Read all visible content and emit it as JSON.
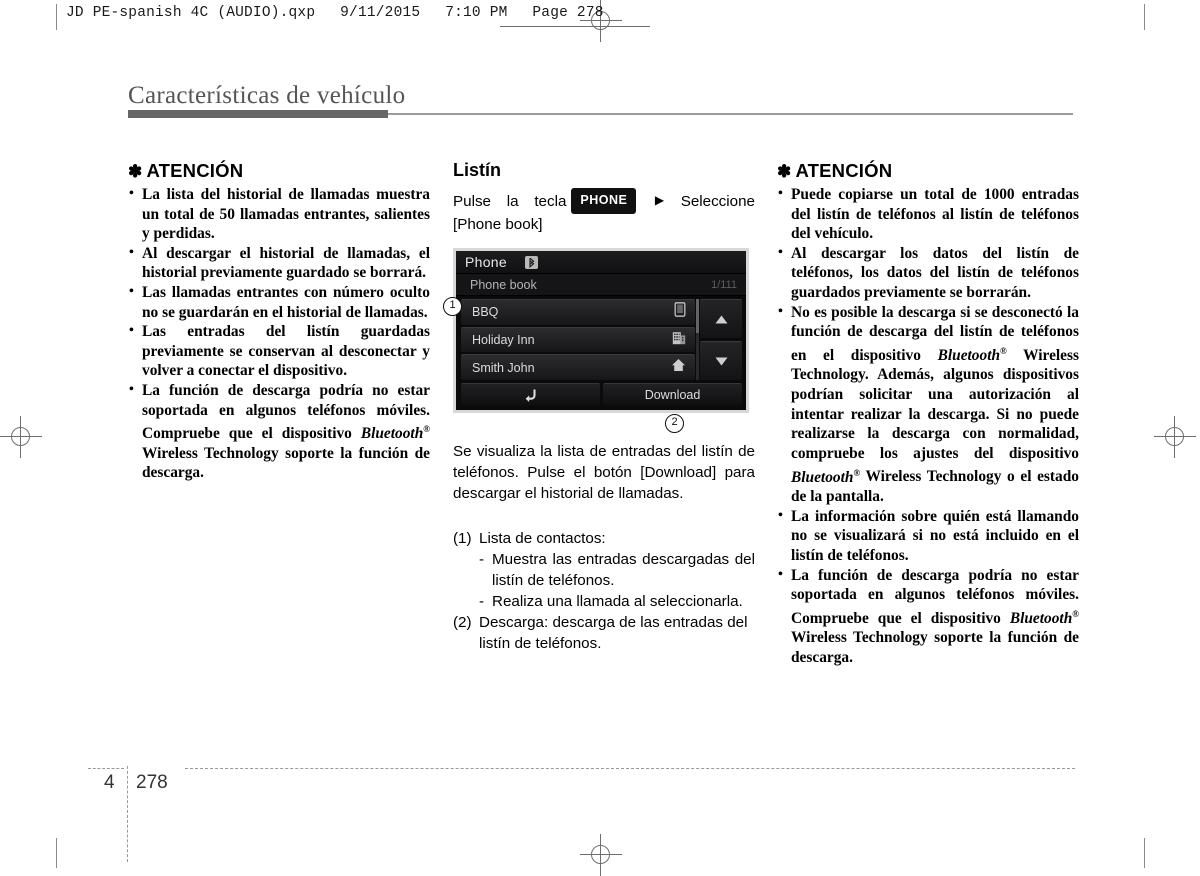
{
  "print_header": {
    "filename": "JD PE-spanish 4C (AUDIO).qxp",
    "date": "9/11/2015",
    "time": "7:10 PM",
    "page_label": "Page 278"
  },
  "page_title": "Características de vehículo",
  "left_notice": {
    "heading": "ATENCIÓN",
    "star": "✽",
    "items": [
      "La lista del historial de llamadas muestra un total de 50 llamadas entrantes, salientes y perdidas.",
      "Al descargar el historial de llamadas, el historial previamente guardado se borrará.",
      "Las llamadas entrantes con número oculto no se guardarán en el historial de llamadas.",
      "Las entradas del listín guardadas previamente se conservan al desconectar y volver a conectar el dispositivo."
    ],
    "last_item_prefix": "La función de descarga podría no estar soportada en algunos teléfonos móviles. Compruebe que el dispositivo ",
    "bluetooth_word": "Bluetooth",
    "registered": "®",
    "last_item_suffix": " Wireless Technology soporte la función de descarga."
  },
  "middle": {
    "section_heading": "Listín",
    "step_prefix": "Pulse la tecla",
    "key_label": "PHONE",
    "arrow": "▶",
    "step_suffix": "Seleccione [Phone book]",
    "description": "Se visualiza la lista de entradas del listín de teléfonos. Pulse el botón [Download] para descargar el historial de llamadas.",
    "numbered_list": [
      {
        "num": "(1)",
        "text": "Lista de contactos:",
        "subitems": [
          "Muestra las entradas descargadas del listín de teléfonos.",
          "Realiza una llamada al seleccionarla."
        ]
      },
      {
        "num": "(2)",
        "text": "Descarga: descarga de las entradas del listín de teléfonos.",
        "subitems": []
      }
    ],
    "dash": "-"
  },
  "device_screen": {
    "title": "Phone",
    "bluetooth_glyph": "ᛒ",
    "subtitle": "Phone book",
    "page_indicator": "1/111",
    "rows": [
      {
        "label": "BBQ",
        "icon": "mobile-phone-icon"
      },
      {
        "label": "Holiday Inn",
        "icon": "office-building-icon"
      },
      {
        "label": "Smith John",
        "icon": "home-icon"
      }
    ],
    "scroll_up": "▲",
    "scroll_down": "▼",
    "back_button": "↰",
    "download_button": "Download",
    "callout_1": "1",
    "callout_2": "2"
  },
  "right_notice": {
    "heading": "ATENCIÓN",
    "star": "✽",
    "items": [
      "Puede copiarse un total de 1000 entradas del listín de teléfonos al listín de teléfonos del vehículo.",
      "Al descargar los datos del listín de teléfonos, los datos del listín de teléfonos guardados previamente se borrarán."
    ],
    "item3": {
      "part1": "No es posible la descarga si se desconectó la función de descarga del listín de teléfonos en el dispositivo ",
      "bt1": "Bluetooth",
      "part2": " Wireless Technology. Además, algunos dispositivos podrían solicitar una autorización al intentar realizar la descarga. Si no puede realizarse la descarga con normalidad, compruebe los ajustes del dispositivo ",
      "bt2": "Bluetooth",
      "part3": " Wireless Technology o el estado de la pantalla."
    },
    "item4": "La información sobre quién está llamando no se visualizará si no está incluido en el listín de teléfonos.",
    "item5": {
      "part1": "La función de descarga podría no estar soportada en algunos teléfonos móviles. Compruebe que el dispositivo ",
      "bt1": "Bluetooth",
      "part2": " Wireless Technology soporte la función de descarga."
    },
    "registered": "®"
  },
  "footer": {
    "chapter": "4",
    "page_number": "278"
  }
}
